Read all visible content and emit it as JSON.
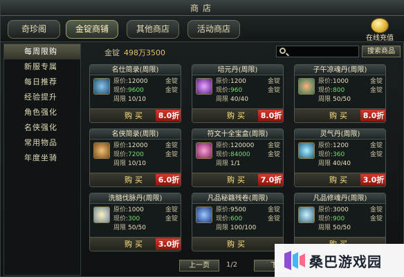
{
  "window": {
    "title": "商店"
  },
  "top_tabs": [
    {
      "label": "奇珍阁",
      "active": false
    },
    {
      "label": "金锭商铺",
      "active": true
    },
    {
      "label": "其他商店",
      "active": false
    },
    {
      "label": "活动商店",
      "active": false
    }
  ],
  "recharge": {
    "label": "在线充值",
    "icon": "gold-ingot-icon"
  },
  "sidebar": {
    "items": [
      {
        "label": "每周限购",
        "active": true
      },
      {
        "label": "新服专属",
        "active": false
      },
      {
        "label": "每日推荐",
        "active": false
      },
      {
        "label": "经验提升",
        "active": false
      },
      {
        "label": "角色强化",
        "active": false
      },
      {
        "label": "名侠强化",
        "active": false
      },
      {
        "label": "常用物品",
        "active": false
      },
      {
        "label": "年度坐骑",
        "active": false
      }
    ]
  },
  "gold": {
    "label": "金锭",
    "value": "498万3500"
  },
  "search": {
    "placeholder": "",
    "button_label": "搜索商品"
  },
  "labels": {
    "orig": "原价:",
    "now": "现价:",
    "limit": "周限",
    "unit": "金锭",
    "buy": "购买"
  },
  "items": [
    {
      "name": "名仕简录(周限)",
      "icon": "scroll-book-icon",
      "orig": "12000",
      "now": "9600",
      "limit": "10/10",
      "discount": "8.0折"
    },
    {
      "name": "培元丹(周限)",
      "icon": "purple-orb-icon",
      "orig": "1200",
      "now": "960",
      "limit": "40/40",
      "discount": "8.0折"
    },
    {
      "name": "子午凉魂丹(周限)",
      "icon": "pill-icon",
      "orig": "1000",
      "now": "800",
      "limit": "50/50",
      "discount": "8.0折"
    },
    {
      "name": "名侠简录(周限)",
      "icon": "bamboo-scroll-icon",
      "orig": "12000",
      "now": "7200",
      "limit": "10/10",
      "discount": "6.0折"
    },
    {
      "name": "符文十全宝盒(周限)",
      "icon": "treasure-box-icon",
      "orig": "120000",
      "now": "84000",
      "limit": "1/1",
      "discount": "7.0折"
    },
    {
      "name": "灵气丹(周限)",
      "icon": "blue-orb-icon",
      "orig": "1200",
      "now": "360",
      "limit": "40/40",
      "discount": "3.0折"
    },
    {
      "name": "洗髓伐脉丹(周限)",
      "icon": "white-pill-icon",
      "orig": "1000",
      "now": "300",
      "limit": "50/50",
      "discount": "3.0折"
    },
    {
      "name": "凡品秘籍残卷(周限)",
      "icon": "blue-book-icon",
      "orig": "9500",
      "now": "600",
      "limit": "100/100",
      "discount": ""
    },
    {
      "name": "凡品修魂丹(周限)",
      "icon": "crystal-orb-icon",
      "orig": "3000",
      "now": "900",
      "limit": "50/50",
      "discount": ""
    }
  ],
  "pager": {
    "prev_label": "上一页",
    "page_text": "1/2",
    "next_label": "下"
  },
  "watermark": {
    "text": "桑巴游戏园"
  }
}
